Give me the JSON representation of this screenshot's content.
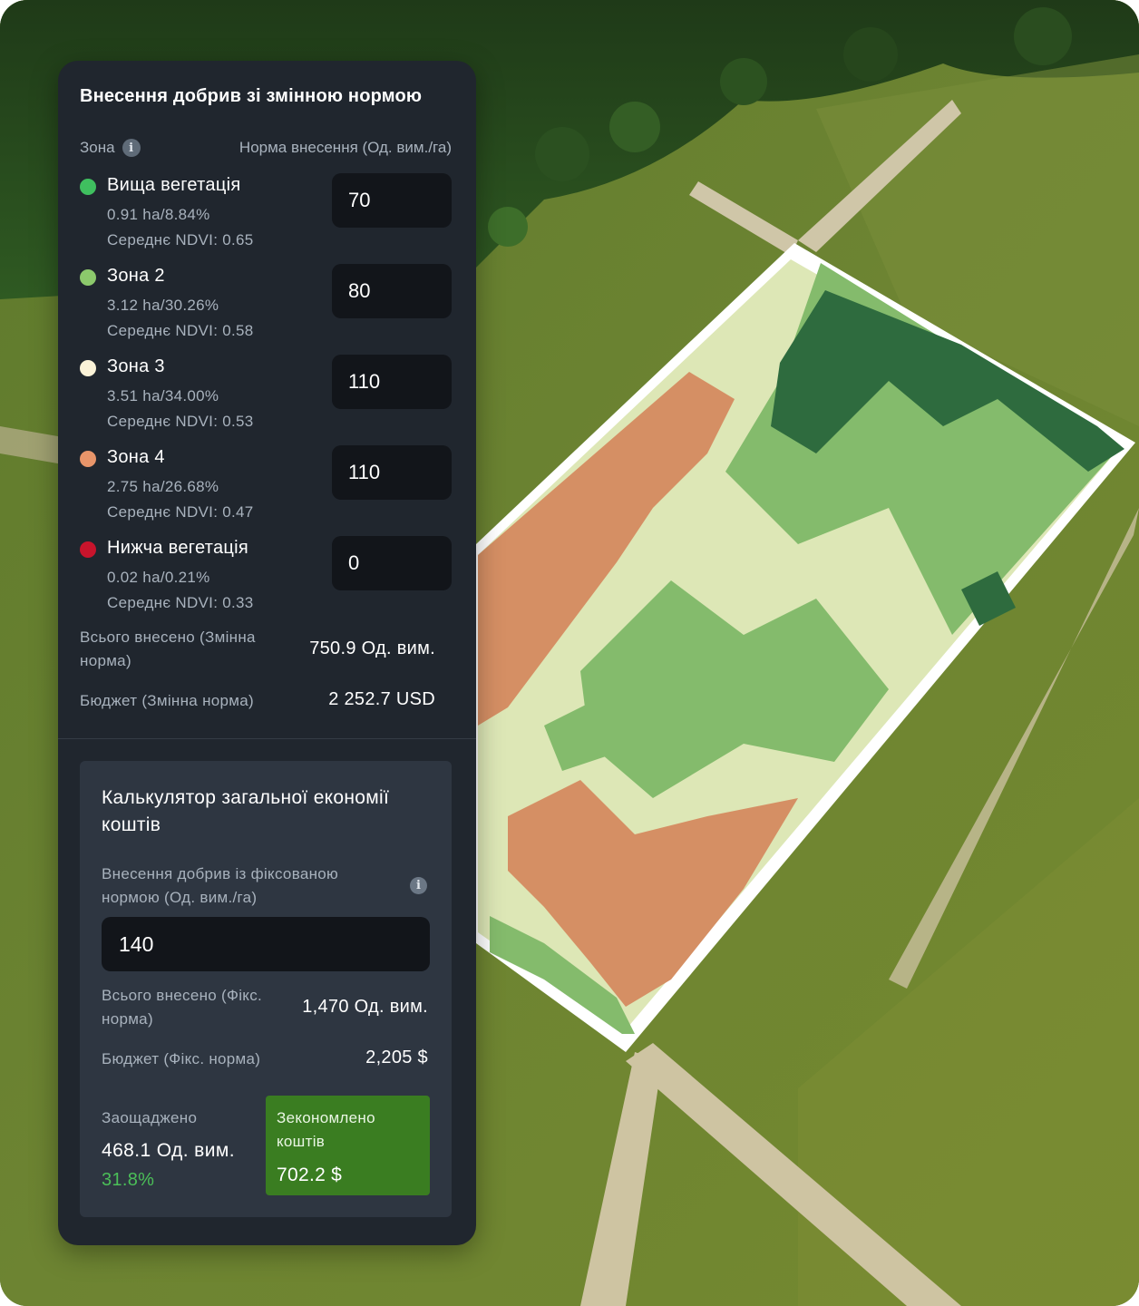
{
  "panel": {
    "title": "Внесення добрив зі змінною нормою",
    "header_zone": "Зона",
    "header_rate": "Норма внесення (Од. вим./га)",
    "zones": [
      {
        "name": "Вища вегетація",
        "area": "0.91 ha/8.84%",
        "ndvi": "Середнє NDVI: 0.65",
        "rate": "70",
        "color": "#3fbf5f"
      },
      {
        "name": "Зона 2",
        "area": "3.12 ha/30.26%",
        "ndvi": "Середнє NDVI: 0.58",
        "rate": "80",
        "color": "#8cc96c"
      },
      {
        "name": "Зона 3",
        "area": "3.51 ha/34.00%",
        "ndvi": "Середнє NDVI: 0.53",
        "rate": "110",
        "color": "#fbf3d8"
      },
      {
        "name": "Зона 4",
        "area": "2.75 ha/26.68%",
        "ndvi": "Середнє NDVI: 0.47",
        "rate": "110",
        "color": "#e8956a"
      },
      {
        "name": "Нижча вегетація",
        "area": "0.02 ha/0.21%",
        "ndvi": "Середнє NDVI: 0.33",
        "rate": "0",
        "color": "#c8142c"
      }
    ],
    "total_label": "Всього внесено (Змінна норма)",
    "total_value": "750.9 Од. вим.",
    "budget_label": "Бюджет (Змінна норма)",
    "budget_value": "2 252.7 USD"
  },
  "calculator": {
    "title": "Калькулятор загальної економії коштів",
    "fixed_label": "Внесення добрив із фіксованою нормою (Од. вим./га)",
    "fixed_value": "140",
    "total_label": "Всього внесено (Фікс. норма)",
    "total_value": "1,470 Од. вим.",
    "budget_label": "Бюджет (Фікс. норма)",
    "budget_value": "2,205 $",
    "saved_label": "Заощаджено",
    "saved_value": "468.1 Од. вим.",
    "saved_percent": "31.8%",
    "money_label": "Зекономлено коштів",
    "money_value": "702.2 $"
  },
  "icons": {
    "info": "info-icon"
  }
}
